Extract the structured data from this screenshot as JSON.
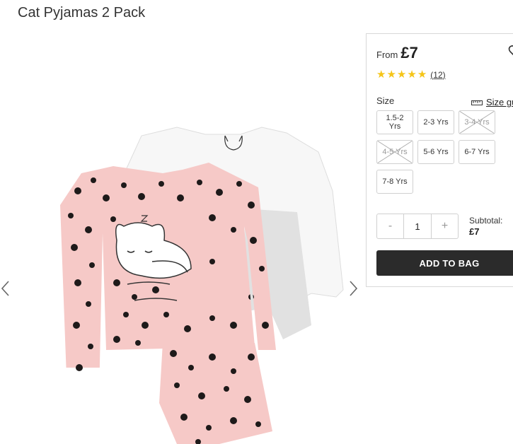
{
  "product": {
    "title": "Cat Pyjamas 2 Pack"
  },
  "price": {
    "from_label": "From",
    "amount": "£7"
  },
  "rating": {
    "stars": 5,
    "count": "12"
  },
  "size": {
    "label": "Size",
    "guide_label": "Size gu",
    "options": [
      {
        "label": "1.5-2 Yrs",
        "available": true
      },
      {
        "label": "2-3 Yrs",
        "available": true
      },
      {
        "label": "3-4 Yrs",
        "available": false
      },
      {
        "label": "4-5 Yrs",
        "available": false
      },
      {
        "label": "5-6 Yrs",
        "available": true
      },
      {
        "label": "6-7 Yrs",
        "available": true
      },
      {
        "label": "7-8 Yrs",
        "available": true
      }
    ]
  },
  "quantity": {
    "decrement": "-",
    "value": "1",
    "increment": "+"
  },
  "subtotal": {
    "label": "Subtotal:",
    "value": "£7"
  },
  "cart": {
    "add_label": "ADD TO BAG"
  },
  "colors": {
    "button": "#2b2b2b",
    "star": "#f5c518",
    "pink": "#f6c9c7",
    "dot": "#1e1a1a"
  }
}
